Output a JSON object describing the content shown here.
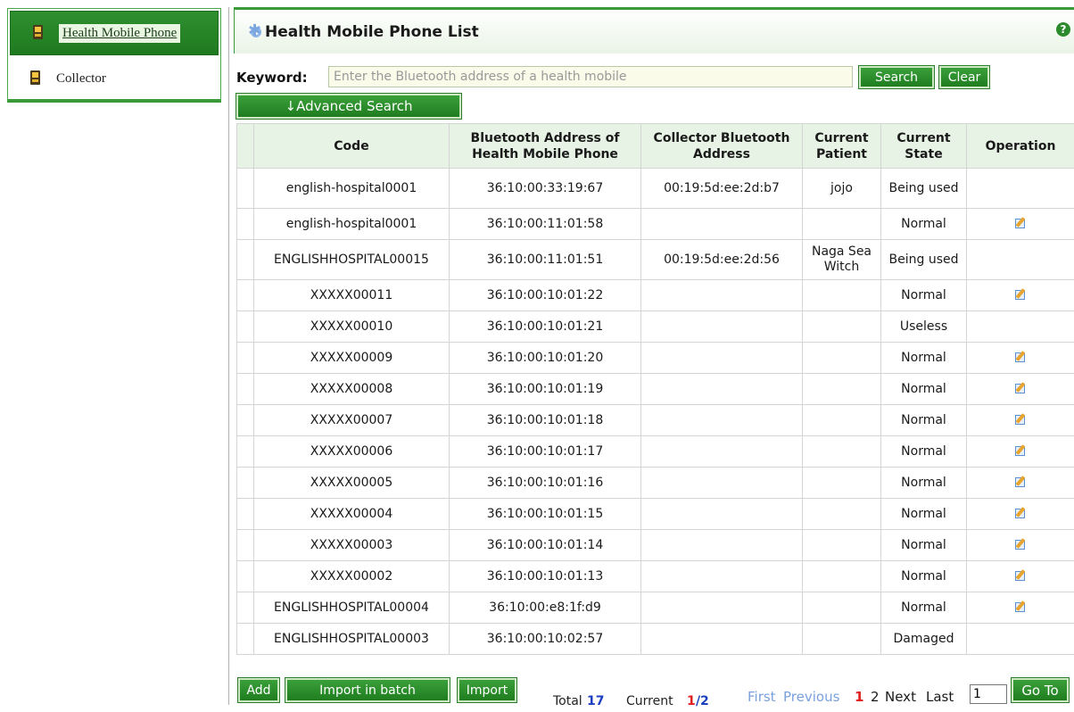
{
  "sidebar": {
    "items": [
      {
        "label": "Health Mobile Phone",
        "icon": "phone-icon",
        "active": true
      },
      {
        "label": "Collector",
        "icon": "phone-icon",
        "active": false
      }
    ]
  },
  "panel": {
    "title": "Health Mobile Phone List",
    "help_icon": "?"
  },
  "search": {
    "keyword_label": "Keyword:",
    "placeholder": "Enter the Bluetooth address of a health mobile",
    "value": "",
    "search_label": "Search",
    "clear_label": "Clear",
    "advanced_label": "↓Advanced Search"
  },
  "table": {
    "columns": [
      "Code",
      "Bluetooth Address of Health Mobile Phone",
      "Collector Bluetooth Address",
      "Current Patient",
      "Current State",
      "Operation"
    ],
    "rows": [
      {
        "code": "english-hospital0001",
        "bt": "36:10:00:33:19:67",
        "collector": "00:19:5d:ee:2d:b7",
        "patient": "jojo",
        "state": "Being used",
        "editable": false
      },
      {
        "code": "english-hospital0001",
        "bt": "36:10:00:11:01:58",
        "collector": "",
        "patient": "",
        "state": "Normal",
        "editable": true
      },
      {
        "code": "ENGLISHHOSPITAL00015",
        "bt": "36:10:00:11:01:51",
        "collector": "00:19:5d:ee:2d:56",
        "patient": "Naga Sea Witch",
        "state": "Being used",
        "editable": false
      },
      {
        "code": "XXXXX00011",
        "bt": "36:10:00:10:01:22",
        "collector": "",
        "patient": "",
        "state": "Normal",
        "editable": true
      },
      {
        "code": "XXXXX00010",
        "bt": "36:10:00:10:01:21",
        "collector": "",
        "patient": "",
        "state": "Useless",
        "editable": false
      },
      {
        "code": "XXXXX00009",
        "bt": "36:10:00:10:01:20",
        "collector": "",
        "patient": "",
        "state": "Normal",
        "editable": true
      },
      {
        "code": "XXXXX00008",
        "bt": "36:10:00:10:01:19",
        "collector": "",
        "patient": "",
        "state": "Normal",
        "editable": true
      },
      {
        "code": "XXXXX00007",
        "bt": "36:10:00:10:01:18",
        "collector": "",
        "patient": "",
        "state": "Normal",
        "editable": true
      },
      {
        "code": "XXXXX00006",
        "bt": "36:10:00:10:01:17",
        "collector": "",
        "patient": "",
        "state": "Normal",
        "editable": true
      },
      {
        "code": "XXXXX00005",
        "bt": "36:10:00:10:01:16",
        "collector": "",
        "patient": "",
        "state": "Normal",
        "editable": true
      },
      {
        "code": "XXXXX00004",
        "bt": "36:10:00:10:01:15",
        "collector": "",
        "patient": "",
        "state": "Normal",
        "editable": true
      },
      {
        "code": "XXXXX00003",
        "bt": "36:10:00:10:01:14",
        "collector": "",
        "patient": "",
        "state": "Normal",
        "editable": true
      },
      {
        "code": "XXXXX00002",
        "bt": "36:10:00:10:01:13",
        "collector": "",
        "patient": "",
        "state": "Normal",
        "editable": true
      },
      {
        "code": "ENGLISHHOSPITAL00004",
        "bt": "36:10:00:e8:1f:d9",
        "collector": "",
        "patient": "",
        "state": "Normal",
        "editable": true
      },
      {
        "code": "ENGLISHHOSPITAL00003",
        "bt": "36:10:00:10:02:57",
        "collector": "",
        "patient": "",
        "state": "Damaged",
        "editable": false
      }
    ]
  },
  "footer": {
    "add_label": "Add",
    "batch_label": "Import in batch",
    "import_label": "Import",
    "total_label": "Total",
    "total_value": "17",
    "current_label": "Current",
    "current_page": "1",
    "page_sep": "/",
    "total_pages": "2",
    "first_label": "First",
    "prev_label": "Previous",
    "page_links": [
      "1",
      "2"
    ],
    "next_label": "Next",
    "last_label": "Last",
    "goto_value": "1",
    "goto_label": "Go To"
  },
  "colors": {
    "brand_green": "#2f8f2f",
    "header_bg": "#e7f3e4",
    "input_bg": "#fbfbe9",
    "link_blue": "#1b3fbf",
    "current_red": "#e01e1e"
  }
}
